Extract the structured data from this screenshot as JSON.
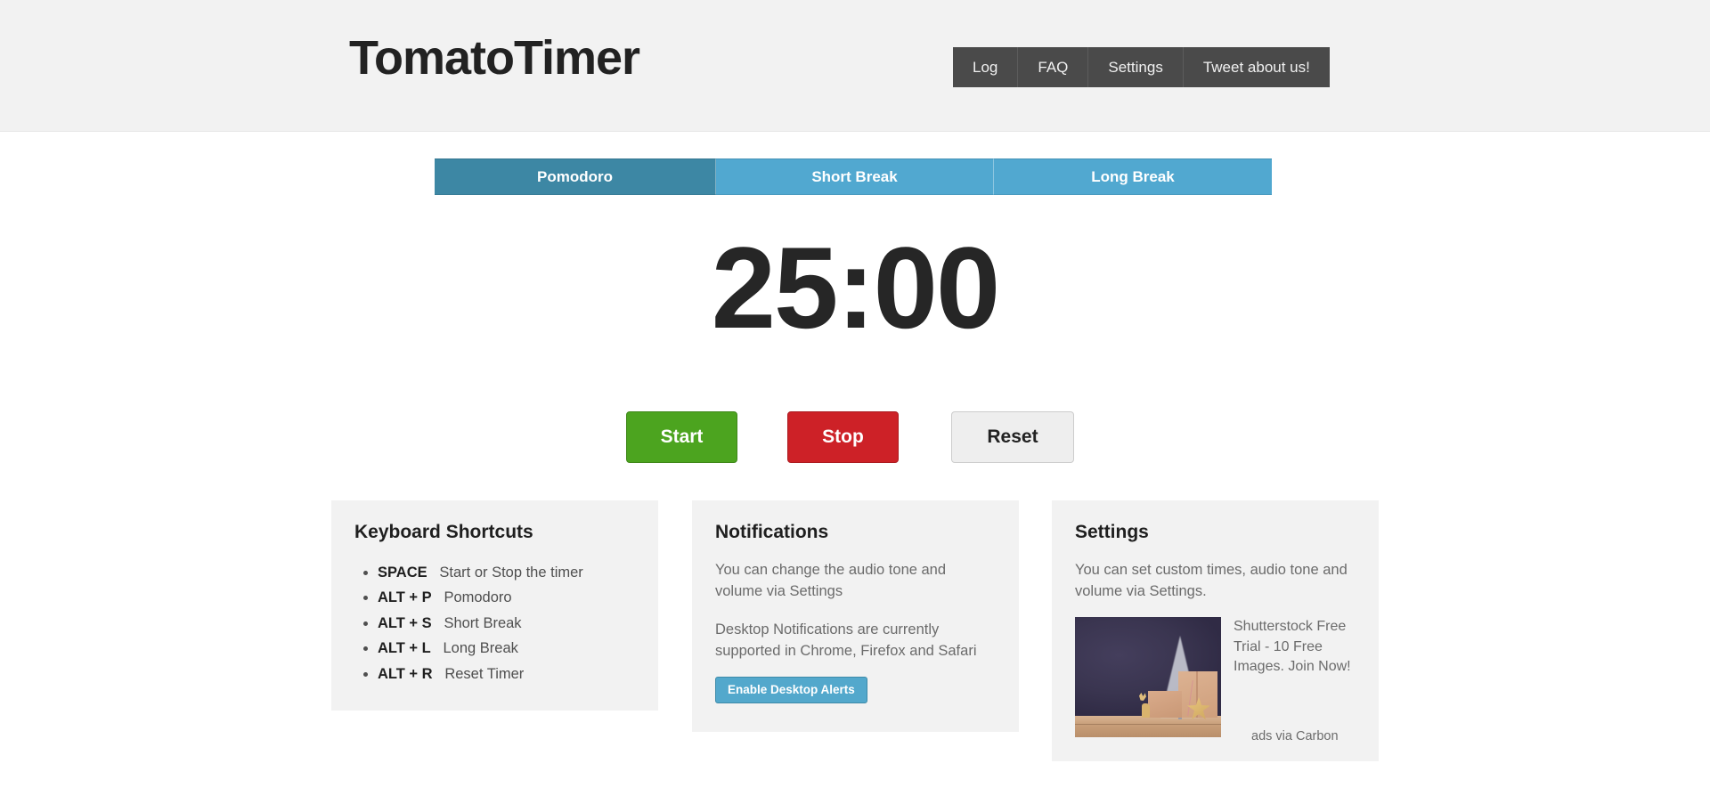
{
  "header": {
    "brand": "TomatoTimer",
    "nav": [
      {
        "label": "Log",
        "name": "nav-log"
      },
      {
        "label": "FAQ",
        "name": "nav-faq"
      },
      {
        "label": "Settings",
        "name": "nav-settings"
      },
      {
        "label": "Tweet about us!",
        "name": "nav-tweet"
      }
    ]
  },
  "tabs": [
    {
      "label": "Pomodoro",
      "active": true
    },
    {
      "label": "Short Break",
      "active": false
    },
    {
      "label": "Long Break",
      "active": false
    }
  ],
  "timer": {
    "display": "25:00",
    "minutes": 25,
    "seconds": 0,
    "mode": "Pomodoro"
  },
  "controls": {
    "start": "Start",
    "stop": "Stop",
    "reset": "Reset"
  },
  "panels": {
    "shortcuts": {
      "title": "Keyboard Shortcuts",
      "items": [
        {
          "keys": "SPACE",
          "desc": "Start or Stop the timer"
        },
        {
          "keys": "ALT + P",
          "desc": "Pomodoro"
        },
        {
          "keys": "ALT + S",
          "desc": "Short Break"
        },
        {
          "keys": "ALT + L",
          "desc": "Long Break"
        },
        {
          "keys": "ALT + R",
          "desc": "Reset Timer"
        }
      ]
    },
    "notifications": {
      "title": "Notifications",
      "paragraph1": "You can change the audio tone and volume via Settings",
      "paragraph2": "Desktop Notifications are currently supported in Chrome, Firefox and Safari",
      "button": "Enable Desktop Alerts"
    },
    "settings": {
      "title": "Settings",
      "paragraph1": "You can set custom times, audio tone and volume via Settings.",
      "ad": {
        "text": "Shutterstock Free Trial - 10 Free Images. Join Now!",
        "via": "ads via Carbon",
        "image_alt": "christmas-scene-ad-image"
      }
    }
  },
  "colors": {
    "header_bg": "#f2f2f2",
    "nav_bg": "#4a4a4a",
    "tab_active": "#3d87a4",
    "tab_idle": "#51a8d0",
    "start_green": "#4ca41f",
    "stop_red": "#cd2127",
    "reset_gray": "#eeeeee",
    "alerts_blue": "#53a8cc",
    "panel_bg": "#f2f2f2",
    "timer_text": "#262626"
  }
}
